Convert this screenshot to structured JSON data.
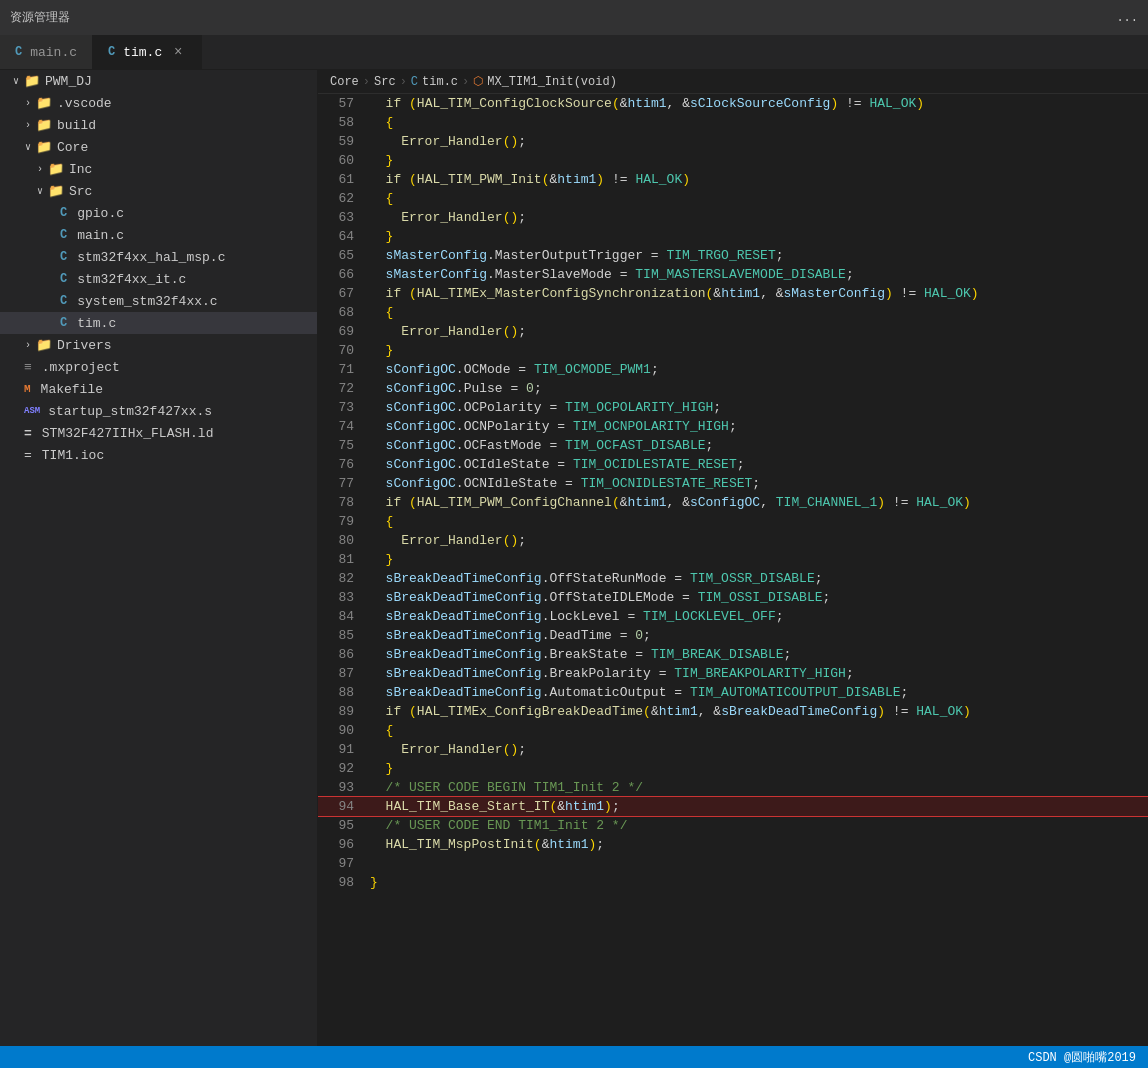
{
  "titleBar": {
    "label": "资源管理器",
    "ellipsis": "..."
  },
  "tabs": [
    {
      "id": "main-c",
      "icon": "C",
      "label": "main.c",
      "active": false,
      "showClose": false
    },
    {
      "id": "tim-c",
      "icon": "C",
      "label": "tim.c",
      "active": true,
      "showClose": true
    }
  ],
  "breadcrumb": {
    "items": [
      "Core",
      "Src",
      "C  tim.c",
      "⬡ MX_TIM1_Init(void)"
    ],
    "separators": [
      ">",
      ">",
      ">"
    ]
  },
  "sidebar": {
    "title": "PWM_DJ",
    "items": [
      {
        "level": 0,
        "arrow": "∨",
        "icon": "folder",
        "label": "PWM_DJ",
        "type": "folder-open"
      },
      {
        "level": 1,
        "arrow": ">",
        "icon": "folder",
        "label": ".vscode",
        "type": "folder"
      },
      {
        "level": 1,
        "arrow": ">",
        "icon": "folder",
        "label": "build",
        "type": "folder"
      },
      {
        "level": 1,
        "arrow": "∨",
        "icon": "folder",
        "label": "Core",
        "type": "folder-open"
      },
      {
        "level": 2,
        "arrow": ">",
        "icon": "folder",
        "label": "Inc",
        "type": "folder"
      },
      {
        "level": 2,
        "arrow": "∨",
        "icon": "folder",
        "label": "Src",
        "type": "folder-open"
      },
      {
        "level": 3,
        "arrow": "",
        "icon": "C",
        "label": "gpio.c",
        "type": "c-file"
      },
      {
        "level": 3,
        "arrow": "",
        "icon": "C",
        "label": "main.c",
        "type": "c-file"
      },
      {
        "level": 3,
        "arrow": "",
        "icon": "C",
        "label": "stm32f4xx_hal_msp.c",
        "type": "c-file"
      },
      {
        "level": 3,
        "arrow": "",
        "icon": "C",
        "label": "stm32f4xx_it.c",
        "type": "c-file"
      },
      {
        "level": 3,
        "arrow": "",
        "icon": "C",
        "label": "system_stm32f4xx.c",
        "type": "c-file"
      },
      {
        "level": 3,
        "arrow": "",
        "icon": "C",
        "label": "tim.c",
        "type": "c-file",
        "active": true
      },
      {
        "level": 1,
        "arrow": ">",
        "icon": "folder",
        "label": "Drivers",
        "type": "folder"
      },
      {
        "level": 0,
        "arrow": "",
        "icon": "mxproject",
        "label": ".mxproject",
        "type": "other"
      },
      {
        "level": 0,
        "arrow": "",
        "icon": "M",
        "label": "Makefile",
        "type": "makefile"
      },
      {
        "level": 0,
        "arrow": "",
        "icon": "ASM",
        "label": "startup_stm32f427xx.s",
        "type": "asm"
      },
      {
        "level": 0,
        "arrow": "",
        "icon": "=",
        "label": "STM32F427IIHx_FLASH.ld",
        "type": "ld"
      },
      {
        "level": 0,
        "arrow": "",
        "icon": "ioc",
        "label": "TIM1.ioc",
        "type": "ioc"
      }
    ]
  },
  "codeLines": [
    {
      "num": 57,
      "content": "  if (HAL_TIM_ConfigClockSource(&htim1, &sClockSourceConfig) != HAL_OK)",
      "highlight": false
    },
    {
      "num": 58,
      "content": "  {",
      "highlight": false
    },
    {
      "num": 59,
      "content": "    Error_Handler();",
      "highlight": false
    },
    {
      "num": 60,
      "content": "  }",
      "highlight": false
    },
    {
      "num": 61,
      "content": "  if (HAL_TIM_PWM_Init(&htim1) != HAL_OK)",
      "highlight": false
    },
    {
      "num": 62,
      "content": "  {",
      "highlight": false
    },
    {
      "num": 63,
      "content": "    Error_Handler();",
      "highlight": false
    },
    {
      "num": 64,
      "content": "  }",
      "highlight": false
    },
    {
      "num": 65,
      "content": "  sMasterConfig.MasterOutputTrigger = TIM_TRGO_RESET;",
      "highlight": false
    },
    {
      "num": 66,
      "content": "  sMasterConfig.MasterSlaveMode = TIM_MASTERSLAVEMODE_DISABLE;",
      "highlight": false
    },
    {
      "num": 67,
      "content": "  if (HAL_TIMEx_MasterConfigSynchronization(&htim1, &sMasterConfig) != HAL_OK)",
      "highlight": false
    },
    {
      "num": 68,
      "content": "  {",
      "highlight": false
    },
    {
      "num": 69,
      "content": "    Error_Handler();",
      "highlight": false
    },
    {
      "num": 70,
      "content": "  }",
      "highlight": false
    },
    {
      "num": 71,
      "content": "  sConfigOC.OCMode = TIM_OCMODE_PWM1;",
      "highlight": false
    },
    {
      "num": 72,
      "content": "  sConfigOC.Pulse = 0;",
      "highlight": false
    },
    {
      "num": 73,
      "content": "  sConfigOC.OCPolarity = TIM_OCPOLARITY_HIGH;",
      "highlight": false
    },
    {
      "num": 74,
      "content": "  sConfigOC.OCNPolarity = TIM_OCNPOLARITY_HIGH;",
      "highlight": false
    },
    {
      "num": 75,
      "content": "  sConfigOC.OCFastMode = TIM_OCFAST_DISABLE;",
      "highlight": false
    },
    {
      "num": 76,
      "content": "  sConfigOC.OCIdleState = TIM_OCIDLESTATE_RESET;",
      "highlight": false
    },
    {
      "num": 77,
      "content": "  sConfigOC.OCNIdleState = TIM_OCNIDLESTATE_RESET;",
      "highlight": false
    },
    {
      "num": 78,
      "content": "  if (HAL_TIM_PWM_ConfigChannel(&htim1, &sConfigOC, TIM_CHANNEL_1) != HAL_OK)",
      "highlight": false
    },
    {
      "num": 79,
      "content": "  {",
      "highlight": false
    },
    {
      "num": 80,
      "content": "    Error_Handler();",
      "highlight": false
    },
    {
      "num": 81,
      "content": "  }",
      "highlight": false
    },
    {
      "num": 82,
      "content": "  sBreakDeadTimeConfig.OffStateRunMode = TIM_OSSR_DISABLE;",
      "highlight": false
    },
    {
      "num": 83,
      "content": "  sBreakDeadTimeConfig.OffStateIDLEMode = TIM_OSSI_DISABLE;",
      "highlight": false
    },
    {
      "num": 84,
      "content": "  sBreakDeadTimeConfig.LockLevel = TIM_LOCKLEVEL_OFF;",
      "highlight": false
    },
    {
      "num": 85,
      "content": "  sBreakDeadTimeConfig.DeadTime = 0;",
      "highlight": false
    },
    {
      "num": 86,
      "content": "  sBreakDeadTimeConfig.BreakState = TIM_BREAK_DISABLE;",
      "highlight": false
    },
    {
      "num": 87,
      "content": "  sBreakDeadTimeConfig.BreakPolarity = TIM_BREAKPOLARITY_HIGH;",
      "highlight": false
    },
    {
      "num": 88,
      "content": "  sBreakDeadTimeConfig.AutomaticOutput = TIM_AUTOMATICOUTPUT_DISABLE;",
      "highlight": false
    },
    {
      "num": 89,
      "content": "  if (HAL_TIMEx_ConfigBreakDeadTime(&htim1, &sBreakDeadTimeConfig) != HAL_OK)",
      "highlight": false
    },
    {
      "num": 90,
      "content": "  {",
      "highlight": false
    },
    {
      "num": 91,
      "content": "    Error_Handler();",
      "highlight": false
    },
    {
      "num": 92,
      "content": "  }",
      "highlight": false
    },
    {
      "num": 93,
      "content": "  /* USER CODE BEGIN TIM1_Init 2 */",
      "highlight": false
    },
    {
      "num": 94,
      "content": "  HAL_TIM_Base_Start_IT(&htim1);",
      "highlight": true
    },
    {
      "num": 95,
      "content": "  /* USER CODE END TIM1_Init 2 */",
      "highlight": false
    },
    {
      "num": 96,
      "content": "  HAL_TIM_MspPostInit(&htim1);",
      "highlight": false
    },
    {
      "num": 97,
      "content": "",
      "highlight": false
    },
    {
      "num": 98,
      "content": "}",
      "highlight": false
    }
  ],
  "bottomBar": {
    "watermark": "CSDN @圆啪嘴2019"
  }
}
